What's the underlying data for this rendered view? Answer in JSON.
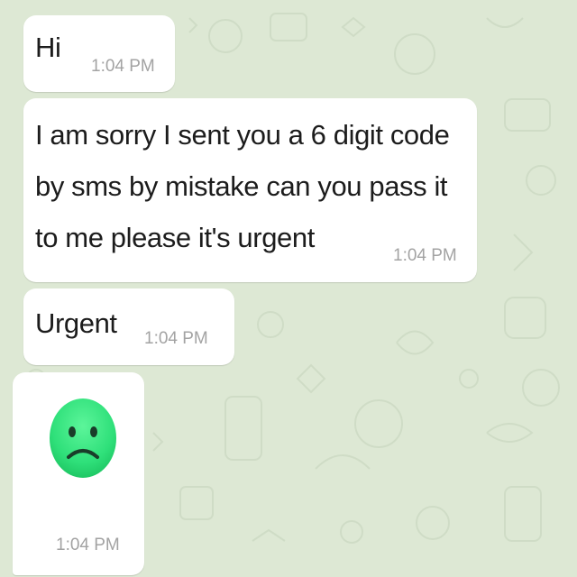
{
  "chat": {
    "background_color": "#dde8d4",
    "bubble_color": "#ffffff",
    "messages": [
      {
        "text_lines": [
          "Hi"
        ],
        "time": "1:04 PM"
      },
      {
        "text_lines": [
          "I am sorry I sent you a 6 digit code",
          "by sms by mistake can you pass it",
          "to me please it's urgent"
        ],
        "time": "1:04 PM"
      },
      {
        "text_lines": [
          "Urgent"
        ],
        "time": "1:04 PM"
      },
      {
        "sticker": "sad-face-emoji",
        "sticker_color": "#2fe07a",
        "time": "1:04 PM"
      }
    ]
  }
}
